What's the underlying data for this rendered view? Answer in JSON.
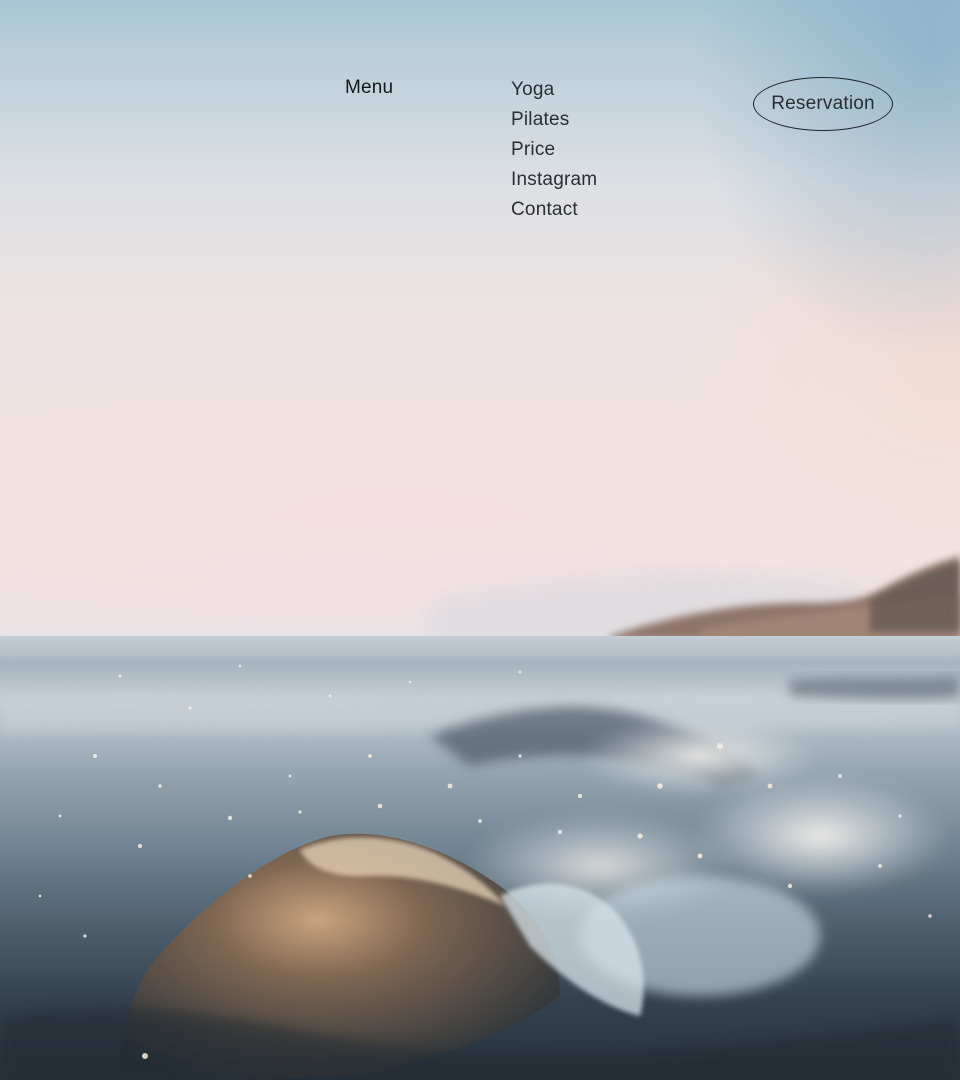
{
  "header": {
    "menu_label": "Menu",
    "nav_items": [
      {
        "label": "Yoga"
      },
      {
        "label": "Pilates"
      },
      {
        "label": "Price"
      },
      {
        "label": "Instagram"
      },
      {
        "label": "Contact"
      }
    ],
    "reservation_label": "Reservation"
  },
  "hero": {
    "image_subject": "ocean-wave-at-sunrise"
  },
  "colors": {
    "text": "#15181d",
    "button_border": "#1f242b",
    "sky_top": "#a9c6d6",
    "sky_pink": "#f3e5e3",
    "sea_dark": "#27313b"
  }
}
